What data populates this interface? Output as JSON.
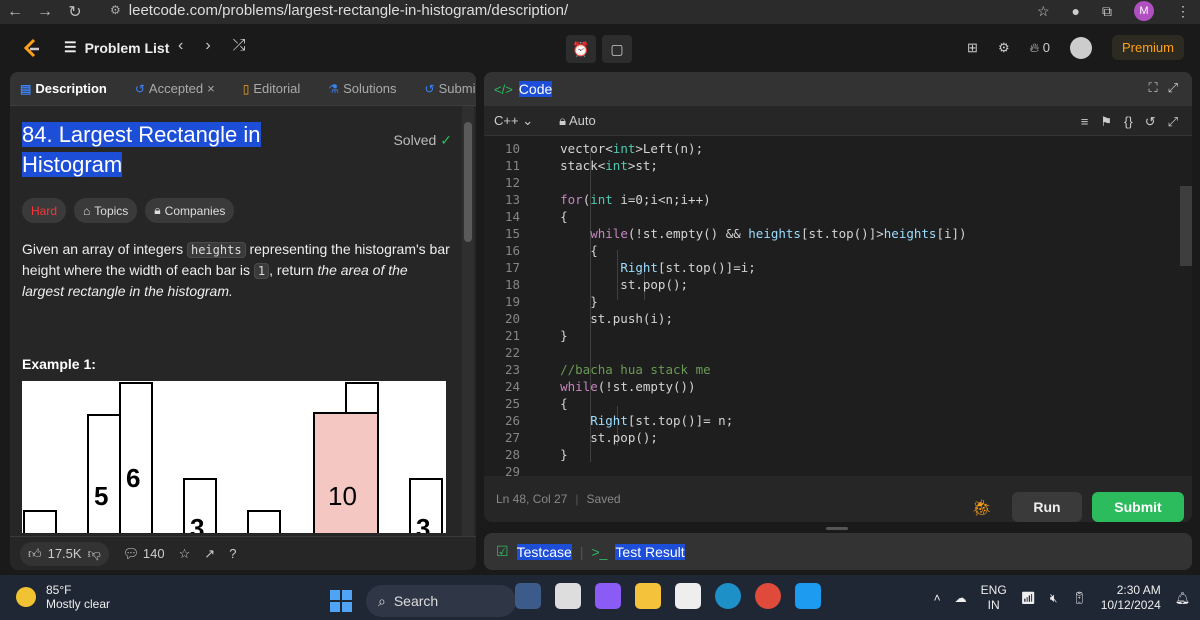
{
  "browser": {
    "url": "leetcode.com/problems/largest-rectangle-in-histogram/description/",
    "profile_initial": "M"
  },
  "nav": {
    "problem_list": "Problem List",
    "premium": "Premium",
    "streak_count": "0"
  },
  "left_tabs": [
    {
      "label": "Description",
      "icon": "description-icon"
    },
    {
      "label": "Accepted",
      "icon": "history-icon"
    },
    {
      "label": "Editorial",
      "icon": "book-icon"
    },
    {
      "label": "Solutions",
      "icon": "flask-icon"
    },
    {
      "label": "Submis",
      "icon": "history-icon"
    }
  ],
  "problem": {
    "title_line1": "84. Largest Rectangle in",
    "title_line2": "Histogram",
    "solved": "Solved",
    "difficulty": "Hard",
    "topics": "Topics",
    "companies": "Companies",
    "desc_part1": "Given an array of integers",
    "desc_code1": "heights",
    "desc_part2": "representing the histogram's bar height where the width of each bar is",
    "desc_code2": "1",
    "desc_part3": ", return",
    "desc_italic": "the area of the largest rectangle in the histogram.",
    "example_title": "Example 1:"
  },
  "histogram_labels": {
    "b5": "5",
    "b6": "6",
    "b3a": "3",
    "b10": "10",
    "b3b": "3"
  },
  "left_footer": {
    "likes": "17.5K",
    "comments": "140"
  },
  "code_panel": {
    "title": "Code",
    "language": "C++",
    "mode": "Auto",
    "status_pos": "Ln 48, Col 27",
    "status_saved": "Saved",
    "run": "Run",
    "submit": "Submit"
  },
  "code": [
    {
      "n": "10",
      "t": "    vector<int>Left(n);"
    },
    {
      "n": "11",
      "t": "    stack<int>st;"
    },
    {
      "n": "12",
      "t": ""
    },
    {
      "n": "13",
      "t": "    for(int i=0;i<n;i++)"
    },
    {
      "n": "14",
      "t": "    {"
    },
    {
      "n": "15",
      "t": "        while(!st.empty() && heights[st.top()]>heights[i])"
    },
    {
      "n": "16",
      "t": "        {"
    },
    {
      "n": "17",
      "t": "            Right[st.top()]=i;"
    },
    {
      "n": "18",
      "t": "            st.pop();"
    },
    {
      "n": "19",
      "t": "        }"
    },
    {
      "n": "20",
      "t": "        st.push(i);"
    },
    {
      "n": "21",
      "t": "    }"
    },
    {
      "n": "22",
      "t": ""
    },
    {
      "n": "23",
      "t": "    //bacha hua stack me"
    },
    {
      "n": "24",
      "t": "    while(!st.empty())"
    },
    {
      "n": "25",
      "t": "    {"
    },
    {
      "n": "26",
      "t": "        Right[st.top()]= n;"
    },
    {
      "n": "27",
      "t": "        st.pop();"
    },
    {
      "n": "28",
      "t": "    }"
    },
    {
      "n": "29",
      "t": ""
    }
  ],
  "bottom": {
    "testcase": "Testcase",
    "test_result": "Test Result"
  },
  "taskbar": {
    "temp": "85°F",
    "weather": "Mostly clear",
    "search": "Search",
    "lang1": "ENG",
    "lang2": "IN",
    "time": "2:30 AM",
    "date": "10/12/2024"
  }
}
